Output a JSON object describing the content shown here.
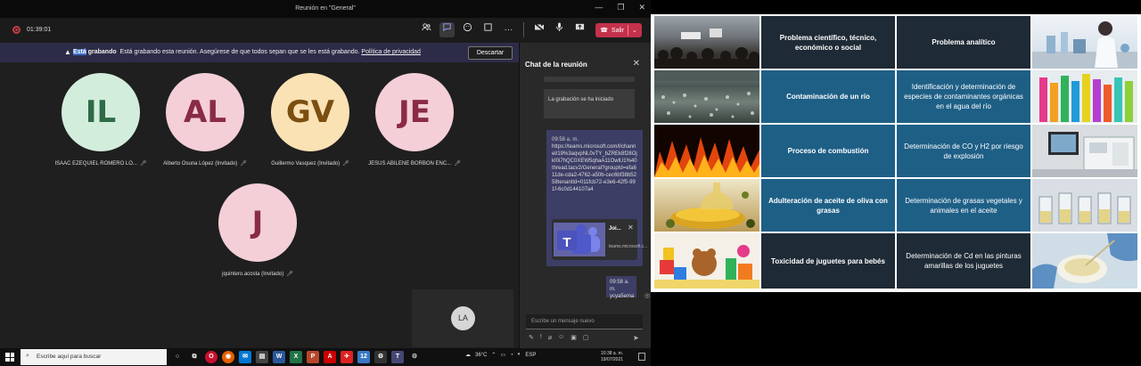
{
  "window": {
    "title": "Reunión en \"General\"",
    "controls": [
      "—",
      "❐",
      "✕"
    ]
  },
  "toolbar": {
    "timer": "01:39:01",
    "icons": [
      "people-icon",
      "chat-icon",
      "reactions-icon",
      "share-tray-icon",
      "more-icon",
      "camera-icon",
      "mic-icon",
      "share-icon"
    ],
    "leave_label": "Salir"
  },
  "banner": {
    "highlight": "Está",
    "title_rest": " grabando",
    "message": "Está grabando esta reunión. Asegúrese de que todos sepan que se les está grabando.",
    "link": "Política de privacidad",
    "dismiss": "Descartar"
  },
  "participants": [
    {
      "initials": "IL",
      "name": "ISAAC EZEQUIEL ROMERO LO...",
      "bg": "#d3eddd",
      "fg": "#2f6b46"
    },
    {
      "initials": "AL",
      "name": "Alberto Osuna López (Invitado)",
      "bg": "#f4cfd8",
      "fg": "#8a2b45"
    },
    {
      "initials": "GV",
      "name": "Guillermo Vasquez (Invitado)",
      "bg": "#fbe2b4",
      "fg": "#7a4f10"
    },
    {
      "initials": "JE",
      "name": "JESUS ABILENE BORBON ENC...",
      "bg": "#f4cfd8",
      "fg": "#8a2b45"
    },
    {
      "initials": "J",
      "name": "jquintero.acosta (Invitado)",
      "bg": "#f4cfd8",
      "fg": "#8a2b45"
    }
  ],
  "self_view": {
    "initials": "LA"
  },
  "chat": {
    "title": "Chat de la reunión",
    "system_message": "La grabación se ha iniciado",
    "link_time": "09:58 a. m.",
    "link_text": "https://teams.microsoft.com/l/channel/19%3aqvpNL0vTY_bZREk8f28OjkI0i7hQC0XEW5qhaA11OwlU1%40thread.tacv2/General?groupId=efa611de-cda2-4762-a50b-cec6bf38b5258tenantId=011fcb72-e3e6-42f5-991f-6c0d144107a4",
    "card_name": "Joi...",
    "card_domain": "teams.microsoft.c...",
    "short_time": "09:58 a. m.",
    "short_text": "ycya5ema",
    "compose_placeholder": "Escribe un mensaje nuevo"
  },
  "taskbar": {
    "search_placeholder": "Escribe aquí para buscar",
    "weather": "36°C",
    "lang": "ESP",
    "time": "10:38 a. m.",
    "date": "19/07/2021"
  },
  "slide": {
    "header": {
      "col1": "Problema científico, técnico, económico o social",
      "col2": "Problema analítico"
    },
    "rows": [
      {
        "problem": "Contaminación de un río",
        "analytic": "Identificación y determinación de especies de contaminantes orgánicas en el agua del río"
      },
      {
        "problem": "Proceso de combustión",
        "analytic": "Determinación de CO y H2 por riesgo de explosión"
      },
      {
        "problem": "Adulteración de aceite de oliva con grasas",
        "analytic": "Determinación de grasas vegetales y animales en el aceite"
      },
      {
        "problem": "Toxicidad de juguetes para bebés",
        "analytic": "Determinación de Cd en las pinturas amarillas de los juguetes"
      }
    ]
  }
}
